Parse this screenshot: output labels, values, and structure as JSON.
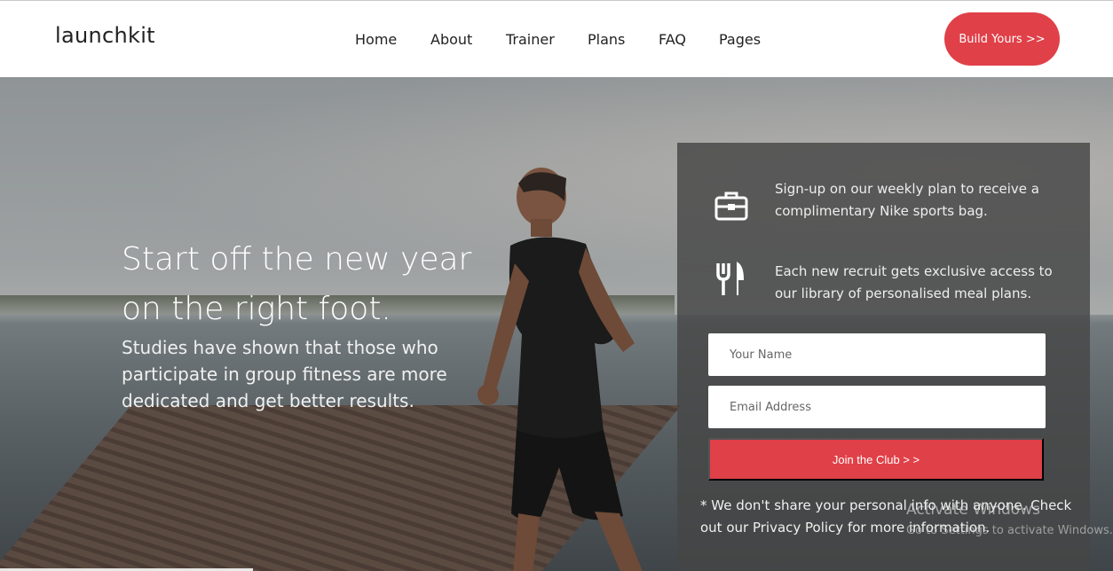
{
  "header": {
    "logo": "launchkit",
    "nav": [
      "Home",
      "About",
      "Trainer",
      "Plans",
      "FAQ",
      "Pages"
    ],
    "cta_label": "Build Yours >>"
  },
  "hero": {
    "heading": "Start off the new year on the right foot.",
    "subtext": "Studies have shown that those who participate in group fitness are more dedicated and get better results."
  },
  "signup": {
    "features": [
      {
        "icon": "briefcase-icon",
        "text": "Sign-up on our weekly plan to receive a complimentary Nike sports bag."
      },
      {
        "icon": "utensils-icon",
        "text": "Each new recruit gets exclusive access to our library of personalised meal plans."
      }
    ],
    "name_placeholder": "Your Name",
    "email_placeholder": "Email Address",
    "join_label": "Join the Club > >",
    "privacy_note": "* We don't share your personal info with anyone. Check out our Privacy Policy for more information."
  },
  "watermark": {
    "title": "Activate Windows",
    "subtitle": "Go to Settings to activate Windows."
  },
  "colors": {
    "accent": "#e04048",
    "panel": "#464646"
  }
}
